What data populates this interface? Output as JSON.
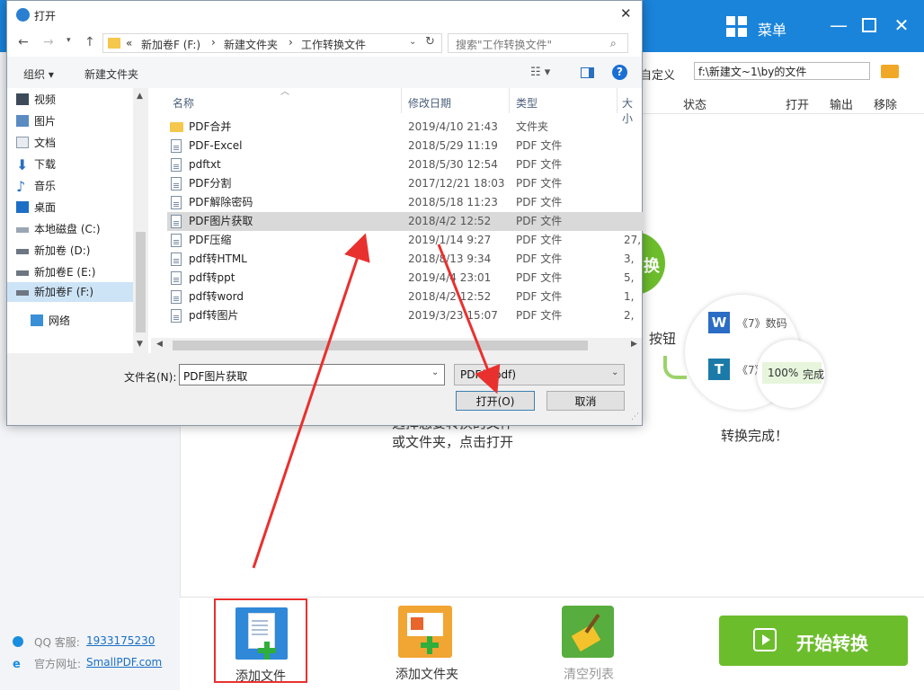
{
  "app": {
    "menu_label": "菜单",
    "toolbar": {
      "custom_label": "自定义",
      "output_path": "f:\\新建文~1\\by的文件"
    },
    "columns": {
      "status": "状态",
      "open": "打开",
      "output": "输出",
      "remove": "移除"
    },
    "hint_left": {
      "line1": "选择您要转换的文件",
      "line2": "或文件夹，点击打开"
    },
    "hint_mid": "按钮",
    "convert_circle_label": "换",
    "completion": {
      "item1": "《7》数码",
      "item2": "《7》",
      "progress": "100%",
      "progress_state": "完成",
      "caption": "转换完成！"
    },
    "contact": {
      "qq_label": "QQ 客服:",
      "qq_number": "1933175230",
      "site_label": "官方网址:",
      "site_url": "SmallPDF.com"
    },
    "bottom": {
      "add_file": "添加文件",
      "add_folder": "添加文件夹",
      "clear_list": "清空列表",
      "start_convert": "开始转换"
    }
  },
  "dialog": {
    "title": "打开",
    "breadcrumb": {
      "prefix": "«",
      "drive": "新加卷F (F:)",
      "sep": "›",
      "folder1": "新建文件夹",
      "folder2": "工作转换文件"
    },
    "search_placeholder": "搜索\"工作转换文件\"",
    "toolbar": {
      "organize": "组织 ▾",
      "new_folder": "新建文件夹"
    },
    "nav": [
      {
        "label": "视频",
        "icon": "video-icon"
      },
      {
        "label": "图片",
        "icon": "picture-icon"
      },
      {
        "label": "文档",
        "icon": "document-icon"
      },
      {
        "label": "下载",
        "icon": "download-icon"
      },
      {
        "label": "音乐",
        "icon": "music-icon"
      },
      {
        "label": "桌面",
        "icon": "desktop-icon"
      },
      {
        "label": "本地磁盘 (C:)",
        "icon": "drive-icon"
      },
      {
        "label": "新加卷 (D:)",
        "icon": "drive-icon"
      },
      {
        "label": "新加卷E (E:)",
        "icon": "drive-icon"
      },
      {
        "label": "新加卷F (F:)",
        "icon": "drive-icon"
      },
      {
        "label": "网络",
        "icon": "network-icon"
      }
    ],
    "columns": {
      "name": "名称",
      "date": "修改日期",
      "type": "类型",
      "size": "大小"
    },
    "files": [
      {
        "name": "PDF合并",
        "date": "2019/4/10 21:43",
        "type": "文件夹",
        "size": "",
        "is_folder": true
      },
      {
        "name": "PDF-Excel",
        "date": "2018/5/29 11:19",
        "type": "PDF 文件",
        "size": ""
      },
      {
        "name": "pdftxt",
        "date": "2018/5/30 12:54",
        "type": "PDF 文件",
        "size": ""
      },
      {
        "name": "PDF分割",
        "date": "2017/12/21 18:03",
        "type": "PDF 文件",
        "size": ""
      },
      {
        "name": "PDF解除密码",
        "date": "2018/5/18 11:23",
        "type": "PDF 文件",
        "size": ""
      },
      {
        "name": "PDF图片获取",
        "date": "2018/4/2 12:52",
        "type": "PDF 文件",
        "size": ""
      },
      {
        "name": "PDF压缩",
        "date": "2019/1/14 9:27",
        "type": "PDF 文件",
        "size": "27,"
      },
      {
        "name": "pdf转HTML",
        "date": "2018/8/13 9:34",
        "type": "PDF 文件",
        "size": "3,"
      },
      {
        "name": "pdf转ppt",
        "date": "2019/4/4 23:01",
        "type": "PDF 文件",
        "size": "5,"
      },
      {
        "name": "pdf转word",
        "date": "2018/4/2 12:52",
        "type": "PDF 文件",
        "size": "1,"
      },
      {
        "name": "pdf转图片",
        "date": "2019/3/23 15:07",
        "type": "PDF 文件",
        "size": "2,"
      }
    ],
    "selected_index": 5,
    "filename_label": "文件名(N):",
    "filename_value": "PDF图片获取",
    "filter_value": "PDF(*.pdf)",
    "open_button": "打开(O)",
    "cancel_button": "取消"
  },
  "colors": {
    "titlebar": "#1a84db",
    "start_button": "#6cbd2c",
    "annotation_red": "#e8312f",
    "selection": "#d9d9d9"
  }
}
